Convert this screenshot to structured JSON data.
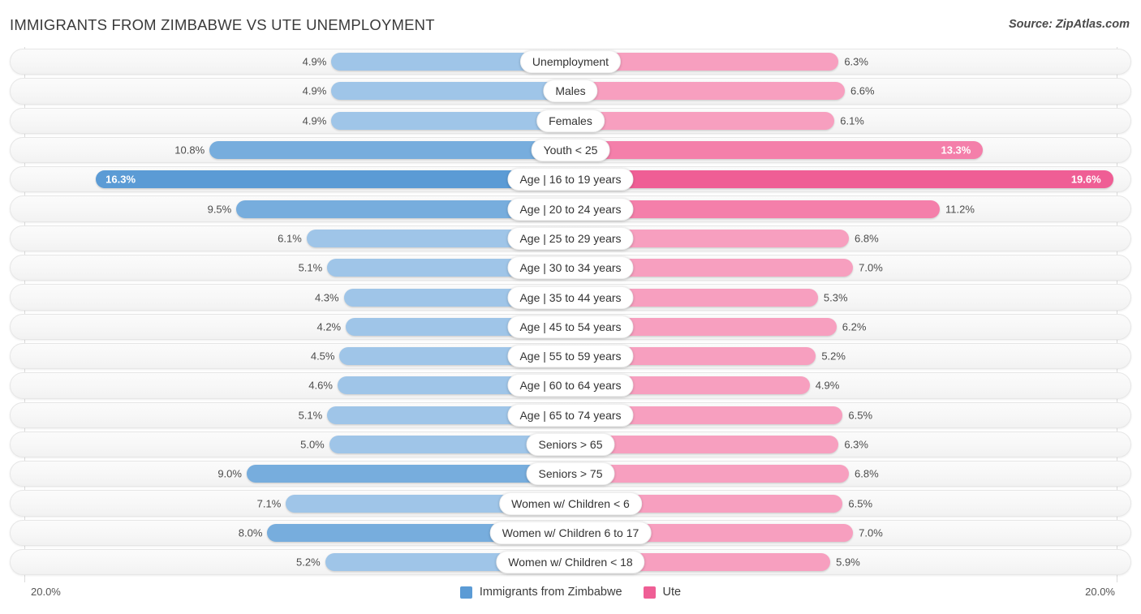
{
  "header": {
    "title": "IMMIGRANTS FROM ZIMBABWE VS UTE UNEMPLOYMENT",
    "source": "Source: ZipAtlas.com"
  },
  "axis": {
    "left_label": "20.0%",
    "right_label": "20.0%",
    "max": 20.0
  },
  "legend": {
    "items": [
      {
        "label": "Immigrants from Zimbabwe",
        "color": "#5B9BD5"
      },
      {
        "label": "Ute",
        "color": "#EF5E95"
      }
    ]
  },
  "colors": {
    "blue_light": "#9FC5E8",
    "blue_mid": "#77ADDD",
    "blue_dark": "#5B9BD5",
    "pink_light": "#F79FBF",
    "pink_mid": "#F47FAA",
    "pink_dark": "#EF5E95"
  },
  "chart_data": {
    "type": "bar",
    "title": "IMMIGRANTS FROM ZIMBABWE VS UTE UNEMPLOYMENT",
    "orientation": "horizontal-diverging",
    "xlabel": "",
    "ylabel": "",
    "xlim": [
      20.0,
      20.0
    ],
    "grid": true,
    "legend_position": "bottom-center",
    "categories": [
      "Unemployment",
      "Males",
      "Females",
      "Youth < 25",
      "Age | 16 to 19 years",
      "Age | 20 to 24 years",
      "Age | 25 to 29 years",
      "Age | 30 to 34 years",
      "Age | 35 to 44 years",
      "Age | 45 to 54 years",
      "Age | 55 to 59 years",
      "Age | 60 to 64 years",
      "Age | 65 to 74 years",
      "Seniors > 65",
      "Seniors > 75",
      "Women w/ Children < 6",
      "Women w/ Children 6 to 17",
      "Women w/ Children < 18"
    ],
    "series": [
      {
        "name": "Immigrants from Zimbabwe",
        "color": "#5B9BD5",
        "values": [
          4.9,
          4.9,
          4.9,
          10.8,
          16.3,
          9.5,
          6.1,
          5.1,
          4.3,
          4.2,
          4.5,
          4.6,
          5.1,
          5.0,
          9.0,
          7.1,
          8.0,
          5.2
        ],
        "labels": [
          "4.9%",
          "4.9%",
          "4.9%",
          "10.8%",
          "16.3%",
          "9.5%",
          "6.1%",
          "5.1%",
          "4.3%",
          "4.2%",
          "4.5%",
          "4.6%",
          "5.1%",
          "5.0%",
          "9.0%",
          "7.1%",
          "8.0%",
          "5.2%"
        ]
      },
      {
        "name": "Ute",
        "color": "#EF5E95",
        "values": [
          6.3,
          6.6,
          6.1,
          13.3,
          19.6,
          11.2,
          6.8,
          7.0,
          5.3,
          6.2,
          5.2,
          4.9,
          6.5,
          6.3,
          6.8,
          6.5,
          7.0,
          5.9
        ],
        "labels": [
          "6.3%",
          "6.6%",
          "6.1%",
          "13.3%",
          "19.6%",
          "11.2%",
          "6.8%",
          "7.0%",
          "5.3%",
          "6.2%",
          "5.2%",
          "4.9%",
          "6.5%",
          "6.3%",
          "6.8%",
          "6.5%",
          "7.0%",
          "5.9%"
        ]
      }
    ]
  }
}
